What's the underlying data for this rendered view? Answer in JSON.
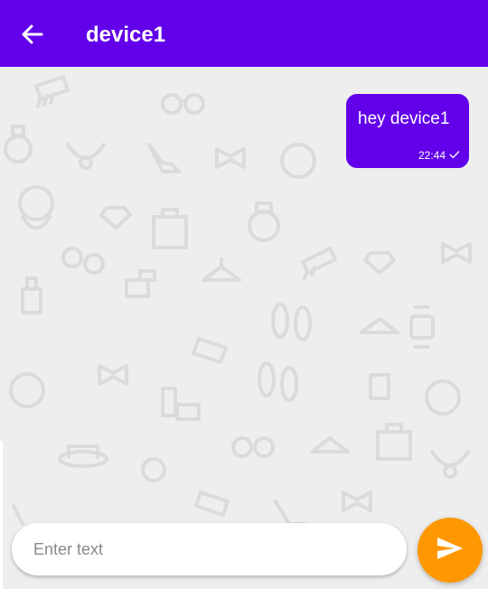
{
  "header": {
    "back_icon": "arrow-left-icon",
    "title": "device1",
    "background_color": "#6200ea"
  },
  "messages": [
    {
      "text": "hey device1",
      "time": "22:44",
      "status_icon": "check-icon",
      "outgoing": true,
      "bubble_color": "#6200ea"
    }
  ],
  "composer": {
    "placeholder": "Enter text",
    "value": "",
    "send_icon": "send-icon",
    "send_color": "#ff9800"
  },
  "background": {
    "pattern_icons": [
      "comb-icon",
      "sunglasses-icon",
      "perfume-icon",
      "high-heel-icon",
      "bow-tie-icon",
      "hat-icon",
      "diamond-icon",
      "shopping-bag-icon",
      "hanger-icon",
      "watch-icon",
      "lipstick-icon",
      "flip-flops-icon",
      "necklace-icon"
    ]
  }
}
